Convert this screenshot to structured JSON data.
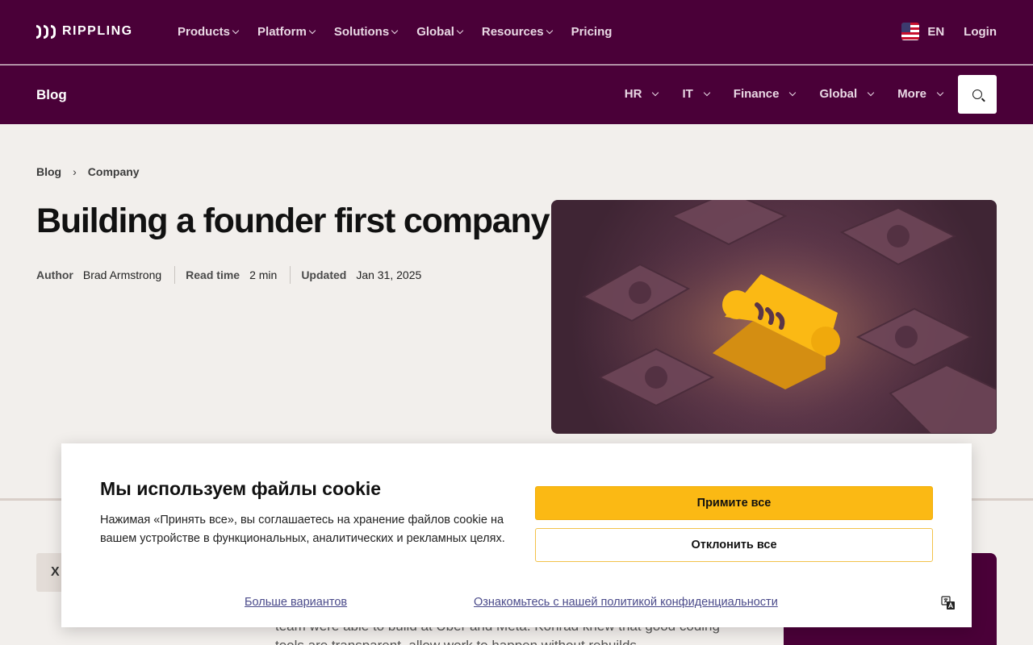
{
  "brand": {
    "name": "RIPPLING"
  },
  "topnav": {
    "items": [
      {
        "label": "Products",
        "dropdown": true
      },
      {
        "label": "Platform",
        "dropdown": true
      },
      {
        "label": "Solutions",
        "dropdown": true
      },
      {
        "label": "Global",
        "dropdown": true
      },
      {
        "label": "Resources",
        "dropdown": true
      },
      {
        "label": "Pricing",
        "dropdown": false
      }
    ],
    "language": "EN",
    "login": "Login"
  },
  "blogbar": {
    "title": "Blog",
    "categories": [
      {
        "label": "HR"
      },
      {
        "label": "IT"
      },
      {
        "label": "Finance"
      },
      {
        "label": "Global"
      },
      {
        "label": "More"
      }
    ],
    "search_icon": "search-icon"
  },
  "breadcrumb": {
    "items": [
      "Blog",
      "Company"
    ],
    "separator": "›"
  },
  "article": {
    "title": "Building a founder first company",
    "author_label": "Author",
    "author": "Brad Armstrong",
    "readtime_label": "Read time",
    "readtime": "2 min",
    "updated_label": "Updated",
    "updated": "Jan 31, 2025",
    "share_icon": "x-icon",
    "share_label": "X",
    "body_excerpt": "team were able to build at Uber and Meta. Konrad knew that good coding tools are transparent, allow work to happen without rebuilds"
  },
  "cookie": {
    "title": "Мы используем файлы cookie",
    "description": "Нажимая «Принять все», вы соглашаетесь на хранение файлов cookie на вашем устройстве в функциональных, аналитических и рекламных целях.",
    "accept": "Примите все",
    "reject": "Отклонить все",
    "more_options": "Больше вариантов",
    "policy_link": "Ознакомьтесь с нашей политикой конфиденциальности",
    "translate_icon": "translate-icon"
  },
  "colors": {
    "brand_plum": "#4a0038",
    "accent_yellow": "#fbb914",
    "page_bg": "#f2efec"
  }
}
